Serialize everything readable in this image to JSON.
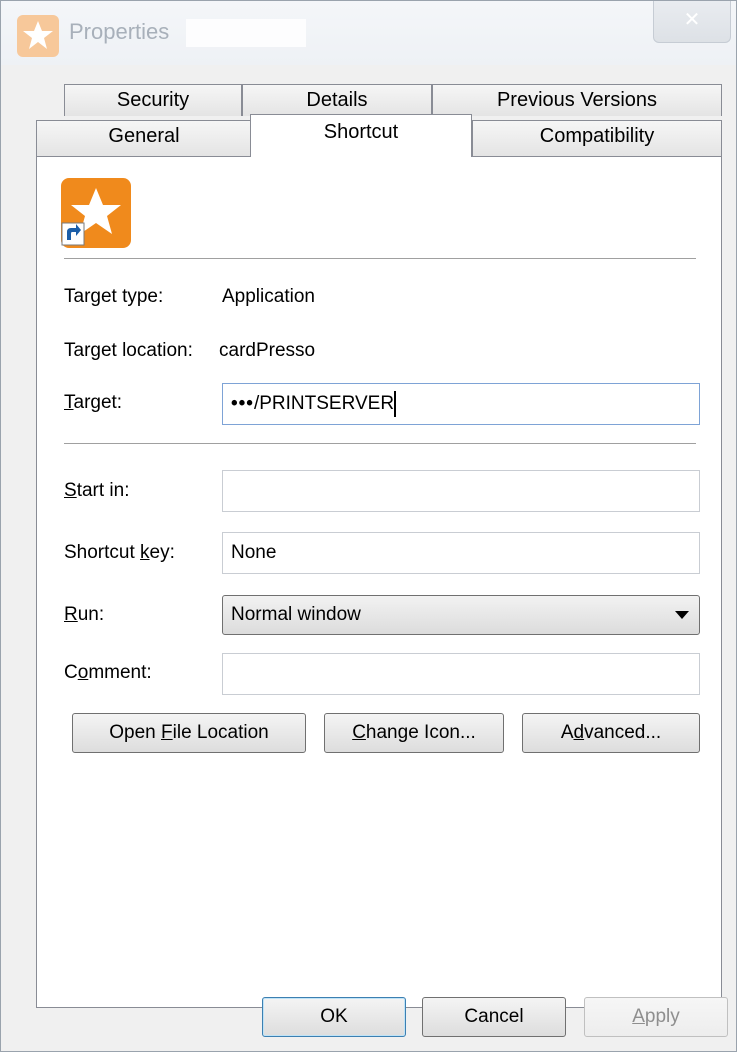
{
  "window": {
    "title": "Properties"
  },
  "tabs_row_top": [
    {
      "label": "Security"
    },
    {
      "label": "Details"
    },
    {
      "label": "Previous Versions"
    }
  ],
  "tabs_row_bottom": [
    {
      "label": "General"
    },
    {
      "label": "Shortcut",
      "active": true
    },
    {
      "label": "Compatibility"
    }
  ],
  "fields": {
    "target_type": {
      "label": "Target type:",
      "value": "Application"
    },
    "target_location": {
      "label": "Target location:",
      "value": "cardPresso"
    },
    "target": {
      "label_pre": "",
      "label_u": "T",
      "label_post": "arget:",
      "value": "/PRINTSERVER"
    },
    "start_in": {
      "label_pre": "",
      "label_u": "S",
      "label_post": "tart in:",
      "value": ""
    },
    "shortcut_key": {
      "label_pre": "Shortcut ",
      "label_u": "k",
      "label_post": "ey:",
      "value": "None"
    },
    "run": {
      "label_pre": "",
      "label_u": "R",
      "label_post": "un:",
      "value": "Normal window"
    },
    "comment": {
      "label_pre": "C",
      "label_u": "o",
      "label_post": "mment:",
      "value": ""
    }
  },
  "buttons": {
    "open_file_location": {
      "pre": "Open ",
      "u": "F",
      "post": "ile Location"
    },
    "change_icon": {
      "pre": "",
      "u": "C",
      "post": "hange Icon..."
    },
    "advanced": {
      "pre": "A",
      "u": "d",
      "post": "vanced..."
    },
    "ok": {
      "label": "OK"
    },
    "cancel": {
      "label": "Cancel"
    },
    "apply": {
      "pre": "",
      "u": "A",
      "post": "pply"
    }
  },
  "colors": {
    "accent_icon": "#f08a1c",
    "focus_border": "#7ea3d6"
  }
}
